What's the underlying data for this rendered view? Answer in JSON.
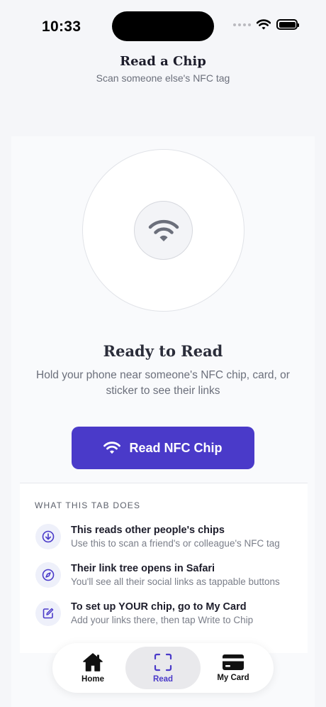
{
  "status": {
    "time": "10:33"
  },
  "header": {
    "title": "Read a Chip",
    "subtitle": "Scan someone else's NFC tag"
  },
  "scanner": {
    "icon": "wifi-icon",
    "title": "Ready to Read",
    "description": "Hold your phone near someone's NFC chip, card, or sticker to see their links"
  },
  "read_button": {
    "label": "Read NFC Chip",
    "icon": "wifi-icon",
    "color": "#4a3ac9"
  },
  "info": {
    "heading": "WHAT THIS TAB DOES",
    "items": [
      {
        "icon": "arrow-down-circle-icon",
        "title": "This reads other people's chips",
        "description": "Use this to scan a friend's or colleague's NFC tag"
      },
      {
        "icon": "compass-icon",
        "title": "Their link tree opens in Safari",
        "description": "You'll see all their social links as tappable buttons"
      },
      {
        "icon": "edit-icon",
        "title": "To set up YOUR chip, go to My Card",
        "description": "Add your links there, then tap Write to Chip"
      }
    ]
  },
  "tabbar": {
    "tabs": [
      {
        "label": "Home",
        "icon": "home-icon",
        "active": false
      },
      {
        "label": "Read",
        "icon": "scan-icon",
        "active": true
      },
      {
        "label": "My Card",
        "icon": "credit-card-icon",
        "active": false
      }
    ]
  }
}
